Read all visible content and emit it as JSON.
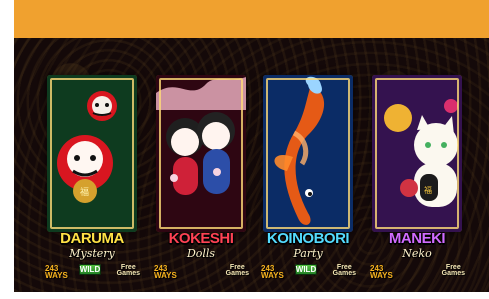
{
  "games": [
    {
      "title": "DARUMA",
      "subtitle": "Mystery",
      "ways": "243\nWAYS",
      "feature": "WILD",
      "free": "Free\nGames",
      "colors": {
        "title": "#ffe245",
        "accent": "#1b8b3b",
        "bg": "#0e3b1f"
      }
    },
    {
      "title": "KOKESHI",
      "subtitle": "Dolls",
      "ways": "243\nWAYS",
      "feature": "",
      "free": "Free\nGames",
      "colors": {
        "title": "#ff4254",
        "accent": "#c31b3c",
        "bg": "#2e0612"
      }
    },
    {
      "title": "KOINOBORI",
      "subtitle": "Party",
      "ways": "243\nWAYS",
      "feature": "WILD",
      "free": "Free\nGames",
      "colors": {
        "title": "#54dcff",
        "accent": "#1f82d8",
        "bg": "#0b2c66"
      }
    },
    {
      "title": "MANEKI",
      "subtitle": "Neko",
      "ways": "243\nWAYS",
      "feature": "",
      "free": "Free\nGames",
      "colors": {
        "title": "#d16bff",
        "accent": "#9447c7",
        "bg": "#34124f"
      }
    }
  ]
}
